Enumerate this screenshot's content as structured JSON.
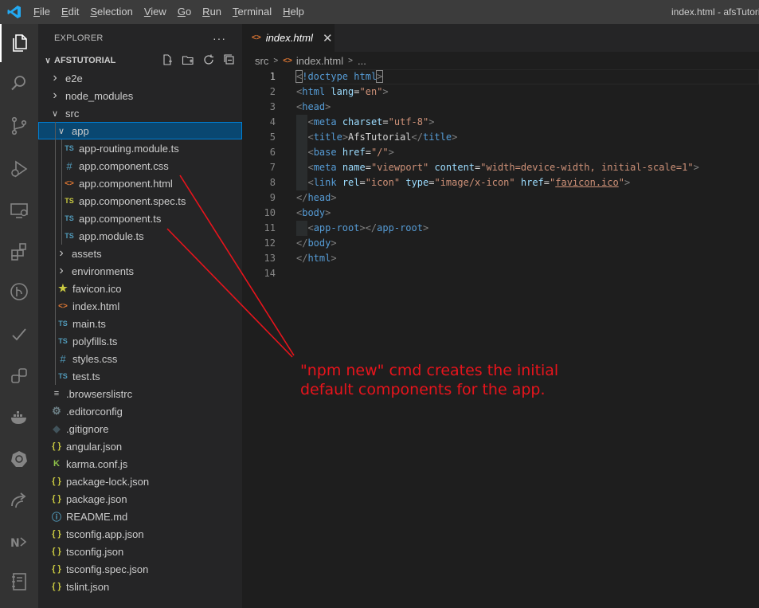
{
  "menu": [
    "File",
    "Edit",
    "Selection",
    "View",
    "Go",
    "Run",
    "Terminal",
    "Help"
  ],
  "window_title": "index.html - afsTutorial",
  "activity_bar": [
    "files-icon",
    "search-icon",
    "source-control-icon",
    "run-debug-icon",
    "remote-explorer-icon",
    "extensions-icon",
    "git-graph-icon",
    "testing-icon",
    "live-share-icon",
    "docker-icon",
    "kubernetes-icon",
    "remote-share-icon",
    "nx-console-icon",
    "notebook-icon"
  ],
  "sidebar": {
    "title": "EXPLORER",
    "more": "···",
    "project": "AFSTUTORIAL",
    "tree": [
      {
        "label": "e2e",
        "depth": 0,
        "type": "folder",
        "open": false
      },
      {
        "label": "node_modules",
        "depth": 0,
        "type": "folder",
        "open": false
      },
      {
        "label": "src",
        "depth": 0,
        "type": "folder",
        "open": true
      },
      {
        "label": "app",
        "depth": 1,
        "type": "folder",
        "open": true,
        "selected": true
      },
      {
        "label": "app-routing.module.ts",
        "depth": 2,
        "type": "ts"
      },
      {
        "label": "app.component.css",
        "depth": 2,
        "type": "css"
      },
      {
        "label": "app.component.html",
        "depth": 2,
        "type": "html"
      },
      {
        "label": "app.component.spec.ts",
        "depth": 2,
        "type": "spec"
      },
      {
        "label": "app.component.ts",
        "depth": 2,
        "type": "ts"
      },
      {
        "label": "app.module.ts",
        "depth": 2,
        "type": "ts"
      },
      {
        "label": "assets",
        "depth": 1,
        "type": "folder",
        "open": false
      },
      {
        "label": "environments",
        "depth": 1,
        "type": "folder",
        "open": false
      },
      {
        "label": "favicon.ico",
        "depth": 1,
        "type": "star"
      },
      {
        "label": "index.html",
        "depth": 1,
        "type": "html"
      },
      {
        "label": "main.ts",
        "depth": 1,
        "type": "ts"
      },
      {
        "label": "polyfills.ts",
        "depth": 1,
        "type": "ts"
      },
      {
        "label": "styles.css",
        "depth": 1,
        "type": "css"
      },
      {
        "label": "test.ts",
        "depth": 1,
        "type": "ts"
      },
      {
        "label": ".browserslistrc",
        "depth": 0,
        "type": "lines"
      },
      {
        "label": ".editorconfig",
        "depth": 0,
        "type": "gear"
      },
      {
        "label": ".gitignore",
        "depth": 0,
        "type": "git"
      },
      {
        "label": "angular.json",
        "depth": 0,
        "type": "json"
      },
      {
        "label": "karma.conf.js",
        "depth": 0,
        "type": "karma"
      },
      {
        "label": "package-lock.json",
        "depth": 0,
        "type": "json"
      },
      {
        "label": "package.json",
        "depth": 0,
        "type": "json"
      },
      {
        "label": "README.md",
        "depth": 0,
        "type": "info"
      },
      {
        "label": "tsconfig.app.json",
        "depth": 0,
        "type": "json"
      },
      {
        "label": "tsconfig.json",
        "depth": 0,
        "type": "json"
      },
      {
        "label": "tsconfig.spec.json",
        "depth": 0,
        "type": "json"
      },
      {
        "label": "tslint.json",
        "depth": 0,
        "type": "json"
      }
    ]
  },
  "editor": {
    "tab_label": "index.html",
    "breadcrumb": [
      "src",
      "index.html",
      "..."
    ],
    "current_line": 1,
    "lines": [
      [
        [
          "brk",
          "<"
        ],
        [
          "tag",
          "!doctype"
        ],
        [
          "txt",
          " "
        ],
        [
          "tag",
          "html"
        ],
        [
          "brk",
          ">"
        ]
      ],
      [
        [
          "brk",
          "<"
        ],
        [
          "tag",
          "html"
        ],
        [
          "txt",
          " "
        ],
        [
          "attr",
          "lang"
        ],
        [
          "eq",
          "="
        ],
        [
          "str",
          "\"en\""
        ],
        [
          "brk",
          ">"
        ]
      ],
      [
        [
          "brk",
          "<"
        ],
        [
          "tag",
          "head"
        ],
        [
          "brk",
          ">"
        ]
      ],
      [
        [
          "txt",
          "  "
        ],
        [
          "brk",
          "<"
        ],
        [
          "tag",
          "meta"
        ],
        [
          "txt",
          " "
        ],
        [
          "attr",
          "charset"
        ],
        [
          "eq",
          "="
        ],
        [
          "str",
          "\"utf-8\""
        ],
        [
          "brk",
          ">"
        ]
      ],
      [
        [
          "txt",
          "  "
        ],
        [
          "brk",
          "<"
        ],
        [
          "tag",
          "title"
        ],
        [
          "brk",
          ">"
        ],
        [
          "txt",
          "AfsTutorial"
        ],
        [
          "brk",
          "</"
        ],
        [
          "tag",
          "title"
        ],
        [
          "brk",
          ">"
        ]
      ],
      [
        [
          "txt",
          "  "
        ],
        [
          "brk",
          "<"
        ],
        [
          "tag",
          "base"
        ],
        [
          "txt",
          " "
        ],
        [
          "attr",
          "href"
        ],
        [
          "eq",
          "="
        ],
        [
          "str",
          "\"/\""
        ],
        [
          "brk",
          ">"
        ]
      ],
      [
        [
          "txt",
          "  "
        ],
        [
          "brk",
          "<"
        ],
        [
          "tag",
          "meta"
        ],
        [
          "txt",
          " "
        ],
        [
          "attr",
          "name"
        ],
        [
          "eq",
          "="
        ],
        [
          "str",
          "\"viewport\""
        ],
        [
          "txt",
          " "
        ],
        [
          "attr",
          "content"
        ],
        [
          "eq",
          "="
        ],
        [
          "str",
          "\"width=device-width, initial-scale=1\""
        ],
        [
          "brk",
          ">"
        ]
      ],
      [
        [
          "txt",
          "  "
        ],
        [
          "brk",
          "<"
        ],
        [
          "tag",
          "link"
        ],
        [
          "txt",
          " "
        ],
        [
          "attr",
          "rel"
        ],
        [
          "eq",
          "="
        ],
        [
          "str",
          "\"icon\""
        ],
        [
          "txt",
          " "
        ],
        [
          "attr",
          "type"
        ],
        [
          "eq",
          "="
        ],
        [
          "str",
          "\"image/x-icon\""
        ],
        [
          "txt",
          " "
        ],
        [
          "attr",
          "href"
        ],
        [
          "eq",
          "="
        ],
        [
          "str",
          "\""
        ],
        [
          "link",
          "favicon.ico"
        ],
        [
          "str",
          "\""
        ],
        [
          "brk",
          ">"
        ]
      ],
      [
        [
          "brk",
          "</"
        ],
        [
          "tag",
          "head"
        ],
        [
          "brk",
          ">"
        ]
      ],
      [
        [
          "brk",
          "<"
        ],
        [
          "tag",
          "body"
        ],
        [
          "brk",
          ">"
        ]
      ],
      [
        [
          "txt",
          "  "
        ],
        [
          "brk",
          "<"
        ],
        [
          "tag",
          "app-root"
        ],
        [
          "brk",
          "></"
        ],
        [
          "tag",
          "app-root"
        ],
        [
          "brk",
          ">"
        ]
      ],
      [
        [
          "brk",
          "</"
        ],
        [
          "tag",
          "body"
        ],
        [
          "brk",
          ">"
        ]
      ],
      [
        [
          "brk",
          "</"
        ],
        [
          "tag",
          "html"
        ],
        [
          "brk",
          ">"
        ]
      ],
      []
    ]
  },
  "annotation": {
    "text_line1": "\"npm new\" cmd creates the initial",
    "text_line2": "default components for the app.",
    "color": "#e8141c"
  },
  "colors": {
    "titlebar": "#3c3c3c",
    "activitybar": "#333333",
    "sidebar": "#252526",
    "editor": "#1e1e1e",
    "selection": "#094771",
    "selection_border": "#007fd4"
  }
}
